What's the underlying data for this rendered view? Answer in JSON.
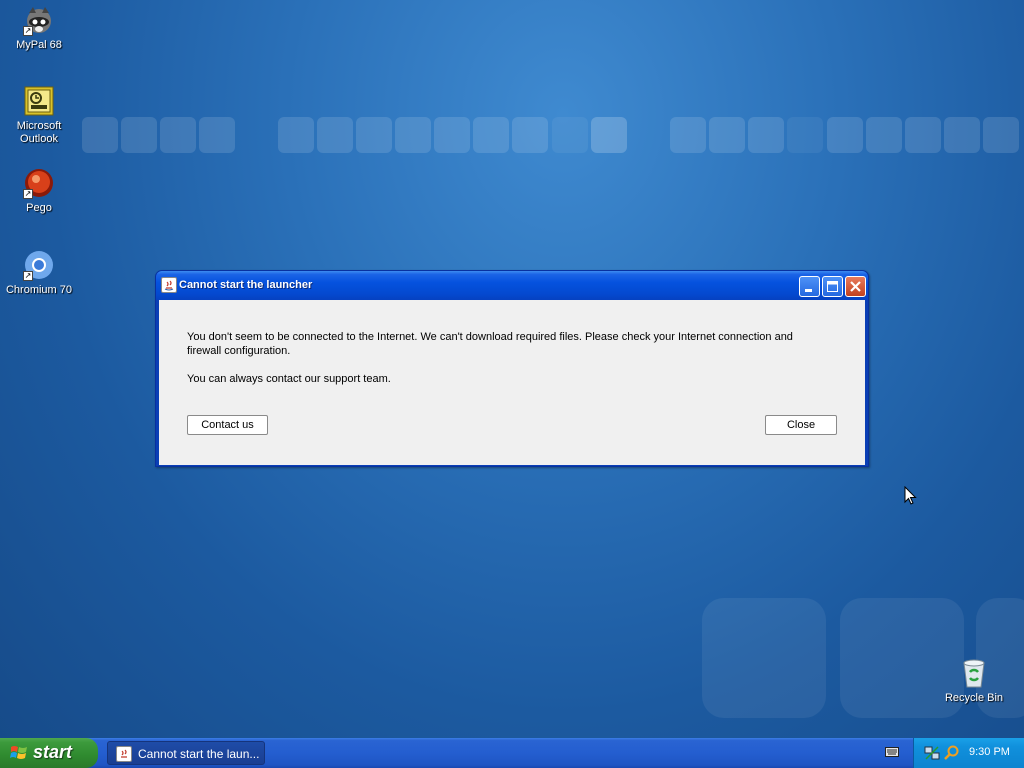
{
  "desktop": {
    "icons": [
      {
        "label": "MyPal 68",
        "icon": "raccoon-icon"
      },
      {
        "label": "Microsoft Outlook",
        "icon": "outlook-icon"
      },
      {
        "label": "Pego",
        "icon": "pego-icon"
      },
      {
        "label": "Chromium 70",
        "icon": "chromium-icon"
      },
      {
        "label": "Recycle Bin",
        "icon": "recycle-bin-icon"
      }
    ]
  },
  "dialog": {
    "title": "Cannot start the launcher",
    "message": "You don't seem to be connected to the Internet. We can't download required files. Please check your Internet connection and firewall configuration.",
    "support_text": "You can always contact our support team.",
    "contact_label": "Contact us",
    "close_label": "Close"
  },
  "taskbar": {
    "start_label": "start",
    "task_label": "Cannot start the laun...",
    "clock": "9:30 PM"
  }
}
